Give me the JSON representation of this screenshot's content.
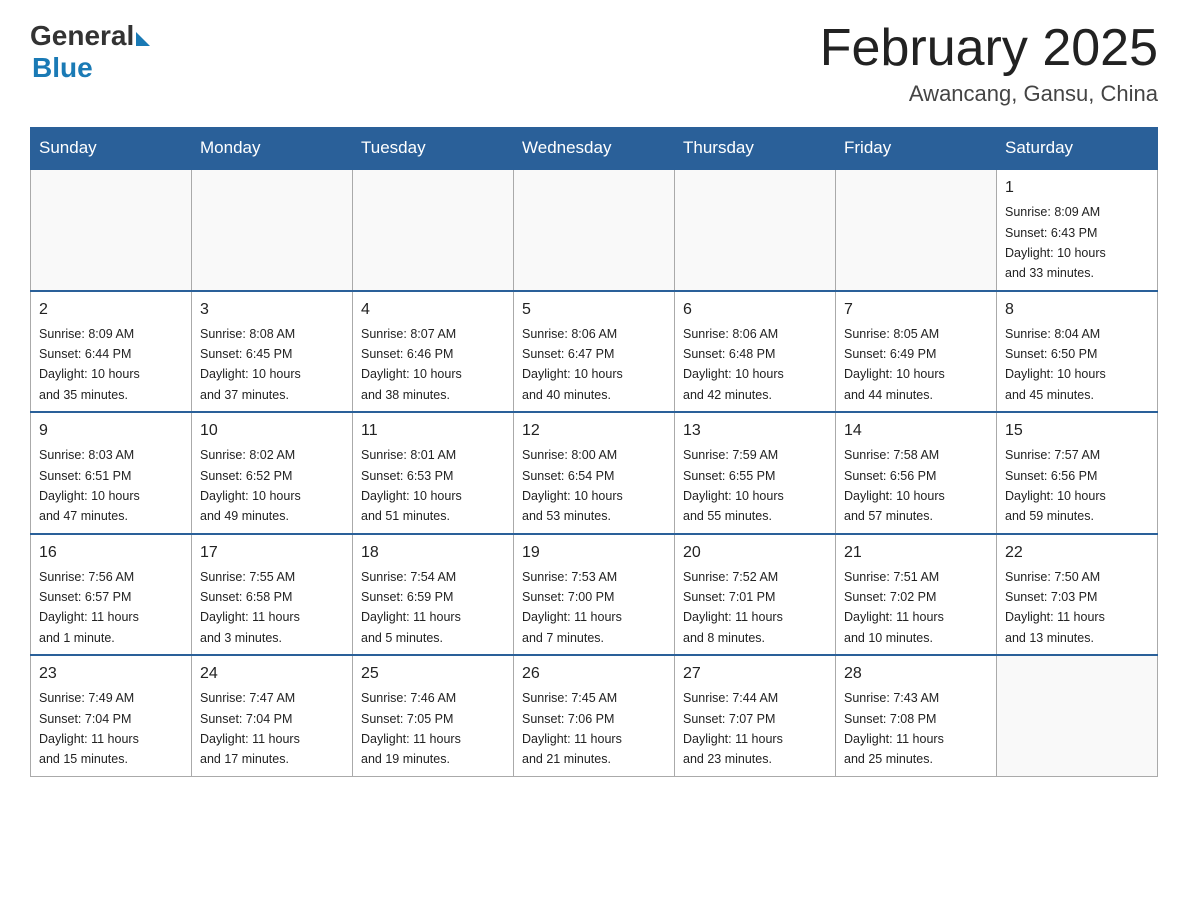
{
  "header": {
    "logo_general": "General",
    "logo_blue": "Blue",
    "title": "February 2025",
    "location": "Awancang, Gansu, China"
  },
  "weekdays": [
    "Sunday",
    "Monday",
    "Tuesday",
    "Wednesday",
    "Thursday",
    "Friday",
    "Saturday"
  ],
  "weeks": [
    [
      {
        "day": "",
        "info": ""
      },
      {
        "day": "",
        "info": ""
      },
      {
        "day": "",
        "info": ""
      },
      {
        "day": "",
        "info": ""
      },
      {
        "day": "",
        "info": ""
      },
      {
        "day": "",
        "info": ""
      },
      {
        "day": "1",
        "info": "Sunrise: 8:09 AM\nSunset: 6:43 PM\nDaylight: 10 hours\nand 33 minutes."
      }
    ],
    [
      {
        "day": "2",
        "info": "Sunrise: 8:09 AM\nSunset: 6:44 PM\nDaylight: 10 hours\nand 35 minutes."
      },
      {
        "day": "3",
        "info": "Sunrise: 8:08 AM\nSunset: 6:45 PM\nDaylight: 10 hours\nand 37 minutes."
      },
      {
        "day": "4",
        "info": "Sunrise: 8:07 AM\nSunset: 6:46 PM\nDaylight: 10 hours\nand 38 minutes."
      },
      {
        "day": "5",
        "info": "Sunrise: 8:06 AM\nSunset: 6:47 PM\nDaylight: 10 hours\nand 40 minutes."
      },
      {
        "day": "6",
        "info": "Sunrise: 8:06 AM\nSunset: 6:48 PM\nDaylight: 10 hours\nand 42 minutes."
      },
      {
        "day": "7",
        "info": "Sunrise: 8:05 AM\nSunset: 6:49 PM\nDaylight: 10 hours\nand 44 minutes."
      },
      {
        "day": "8",
        "info": "Sunrise: 8:04 AM\nSunset: 6:50 PM\nDaylight: 10 hours\nand 45 minutes."
      }
    ],
    [
      {
        "day": "9",
        "info": "Sunrise: 8:03 AM\nSunset: 6:51 PM\nDaylight: 10 hours\nand 47 minutes."
      },
      {
        "day": "10",
        "info": "Sunrise: 8:02 AM\nSunset: 6:52 PM\nDaylight: 10 hours\nand 49 minutes."
      },
      {
        "day": "11",
        "info": "Sunrise: 8:01 AM\nSunset: 6:53 PM\nDaylight: 10 hours\nand 51 minutes."
      },
      {
        "day": "12",
        "info": "Sunrise: 8:00 AM\nSunset: 6:54 PM\nDaylight: 10 hours\nand 53 minutes."
      },
      {
        "day": "13",
        "info": "Sunrise: 7:59 AM\nSunset: 6:55 PM\nDaylight: 10 hours\nand 55 minutes."
      },
      {
        "day": "14",
        "info": "Sunrise: 7:58 AM\nSunset: 6:56 PM\nDaylight: 10 hours\nand 57 minutes."
      },
      {
        "day": "15",
        "info": "Sunrise: 7:57 AM\nSunset: 6:56 PM\nDaylight: 10 hours\nand 59 minutes."
      }
    ],
    [
      {
        "day": "16",
        "info": "Sunrise: 7:56 AM\nSunset: 6:57 PM\nDaylight: 11 hours\nand 1 minute."
      },
      {
        "day": "17",
        "info": "Sunrise: 7:55 AM\nSunset: 6:58 PM\nDaylight: 11 hours\nand 3 minutes."
      },
      {
        "day": "18",
        "info": "Sunrise: 7:54 AM\nSunset: 6:59 PM\nDaylight: 11 hours\nand 5 minutes."
      },
      {
        "day": "19",
        "info": "Sunrise: 7:53 AM\nSunset: 7:00 PM\nDaylight: 11 hours\nand 7 minutes."
      },
      {
        "day": "20",
        "info": "Sunrise: 7:52 AM\nSunset: 7:01 PM\nDaylight: 11 hours\nand 8 minutes."
      },
      {
        "day": "21",
        "info": "Sunrise: 7:51 AM\nSunset: 7:02 PM\nDaylight: 11 hours\nand 10 minutes."
      },
      {
        "day": "22",
        "info": "Sunrise: 7:50 AM\nSunset: 7:03 PM\nDaylight: 11 hours\nand 13 minutes."
      }
    ],
    [
      {
        "day": "23",
        "info": "Sunrise: 7:49 AM\nSunset: 7:04 PM\nDaylight: 11 hours\nand 15 minutes."
      },
      {
        "day": "24",
        "info": "Sunrise: 7:47 AM\nSunset: 7:04 PM\nDaylight: 11 hours\nand 17 minutes."
      },
      {
        "day": "25",
        "info": "Sunrise: 7:46 AM\nSunset: 7:05 PM\nDaylight: 11 hours\nand 19 minutes."
      },
      {
        "day": "26",
        "info": "Sunrise: 7:45 AM\nSunset: 7:06 PM\nDaylight: 11 hours\nand 21 minutes."
      },
      {
        "day": "27",
        "info": "Sunrise: 7:44 AM\nSunset: 7:07 PM\nDaylight: 11 hours\nand 23 minutes."
      },
      {
        "day": "28",
        "info": "Sunrise: 7:43 AM\nSunset: 7:08 PM\nDaylight: 11 hours\nand 25 minutes."
      },
      {
        "day": "",
        "info": ""
      }
    ]
  ]
}
